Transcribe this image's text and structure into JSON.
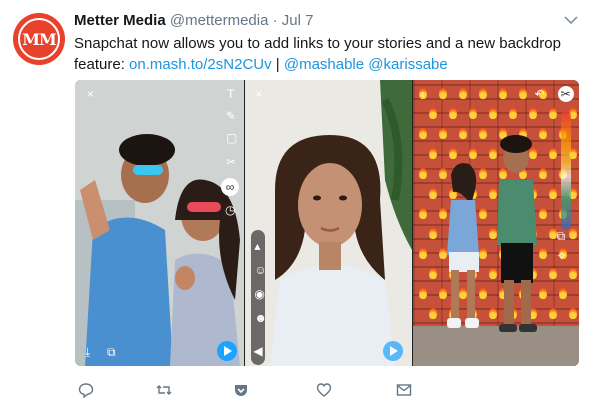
{
  "tweet": {
    "author_name": "Metter Media",
    "handle": "@mettermedia",
    "separator": "·",
    "date": "Jul 7",
    "avatar_text": "MM",
    "text_line1": "Snapchat now allows you to add links to your stories and a new backdrop",
    "text_prefix": "feature: ",
    "link_url": "on.mash.to/2sN2CUv",
    "text_sep": " | ",
    "mention1": "@mashable",
    "mention2": "@karissabe"
  },
  "media": {
    "panels": [
      "couple-with-sunglasses-photo",
      "woman-portrait-photo",
      "couple-on-emoji-backdrop-photo"
    ]
  },
  "actions": [
    "reply-icon",
    "retweet-icon",
    "pocket-icon",
    "like-icon",
    "message-icon"
  ],
  "colors": {
    "link": "#1b95e0",
    "avatar": "#e8412c",
    "text": "#14171a",
    "meta": "#657786"
  }
}
